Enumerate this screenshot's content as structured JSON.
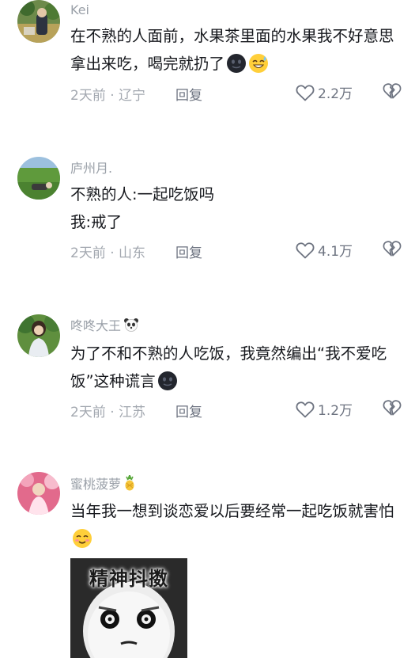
{
  "comments": [
    {
      "username": "Kei",
      "text": "在不熟的人面前，水果茶里面的水果我不好意思拿出来吃，喝完就扔了",
      "text_emojis": [
        "dark-smile-emoji",
        "sweat-smile-emoji"
      ],
      "time": "2天前",
      "location": "辽宁",
      "reply_label": "回复",
      "likes": "2.2万"
    },
    {
      "username": "庐州月.",
      "lines": [
        "不熟的人:一起吃饭吗",
        "我:戒了"
      ],
      "time": "2天前",
      "location": "山东",
      "reply_label": "回复",
      "likes": "4.1万"
    },
    {
      "username": "咚咚大王",
      "username_emoji": "panda-emoji",
      "text": "为了不和不熟的人吃饭，我竟然编出“我不爱吃饭”这种谎言",
      "text_emojis": [
        "dark-smile-emoji"
      ],
      "time": "2天前",
      "location": "江苏",
      "reply_label": "回复",
      "likes": "1.2万"
    },
    {
      "username": "蜜桃菠萝",
      "username_emoji": "pineapple-emoji",
      "text": "当年我一想到谈恋爱以后要经常一起吃饭就害怕",
      "text_emojis": [
        "shy-smile-emoji"
      ],
      "sticker": {
        "caption": "精神抖擞"
      }
    }
  ],
  "separator": "·",
  "colors": {
    "text": "#16181d",
    "muted": "#a3a8b0",
    "username": "#9aa0a8",
    "background": "#ffffff"
  }
}
